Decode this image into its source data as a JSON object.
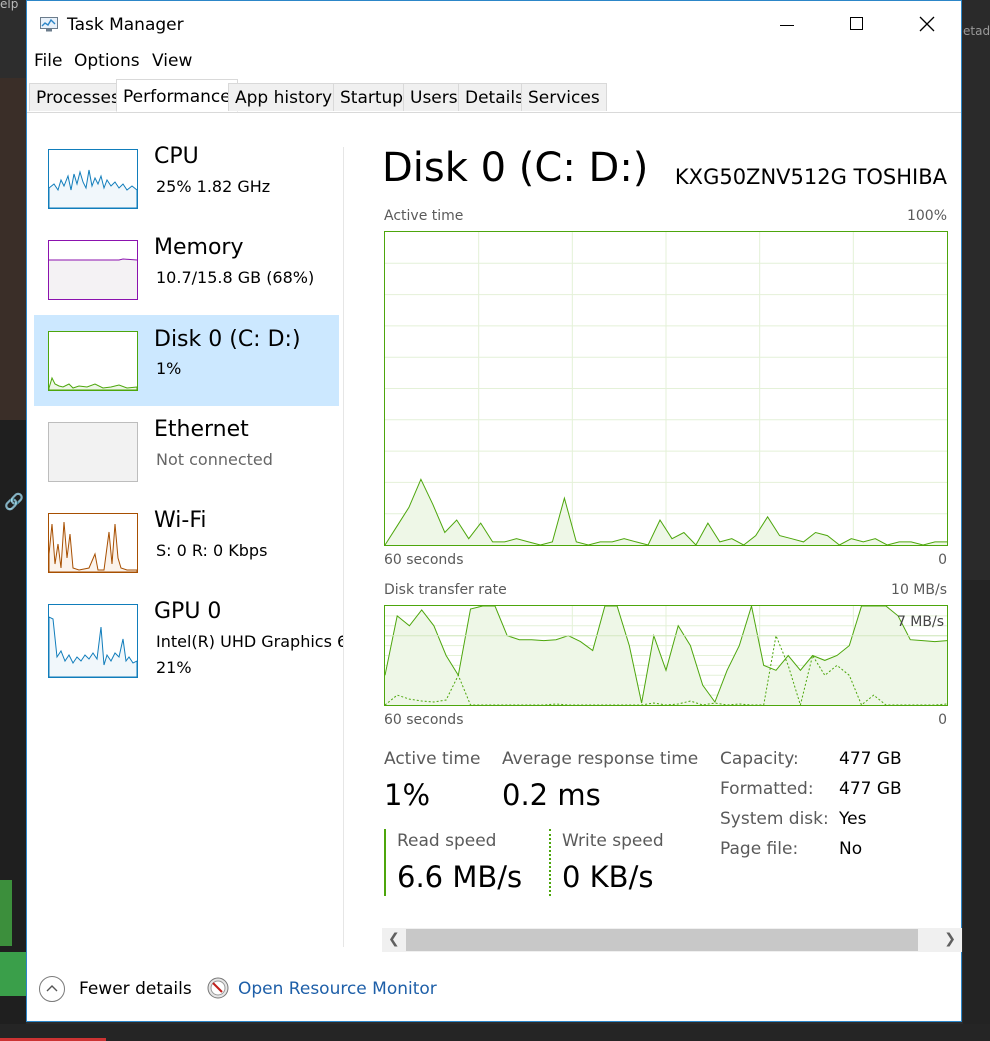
{
  "window": {
    "title": "Task Manager"
  },
  "menu": {
    "file": "File",
    "options": "Options",
    "view": "View"
  },
  "tabs": [
    "Processes",
    "Performance",
    "App history",
    "Startup",
    "Users",
    "Details",
    "Services"
  ],
  "active_tab": "Performance",
  "sidebar": {
    "cpu": {
      "name": "CPU",
      "sub": "25%  1.82 GHz"
    },
    "memory": {
      "name": "Memory",
      "sub": "10.7/15.8 GB (68%)"
    },
    "disk": {
      "name": "Disk 0 (C: D:)",
      "sub": "1%"
    },
    "ethernet": {
      "name": "Ethernet",
      "sub": "Not connected"
    },
    "wifi": {
      "name": "Wi-Fi",
      "sub": "S: 0  R: 0 Kbps"
    },
    "gpu": {
      "name": "GPU 0",
      "sub": "Intel(R) UHD Graphics 6",
      "sub2": "21%"
    }
  },
  "main": {
    "title": "Disk 0 (C: D:)",
    "model": "KXG50ZNV512G TOSHIBA",
    "active_time_label": "Active time",
    "active_time_max": "100%",
    "graph_seconds": "60 seconds",
    "graph_zero": "0",
    "transfer_label": "Disk transfer rate",
    "transfer_max": "10 MB/s",
    "transfer_marker": "7 MB/s"
  },
  "stats": {
    "active_time": {
      "label": "Active time",
      "value": "1%"
    },
    "avg_response": {
      "label": "Average response time",
      "value": "0.2 ms"
    },
    "read_speed": {
      "label": "Read speed",
      "value": "6.6 MB/s"
    },
    "write_speed": {
      "label": "Write speed",
      "value": "0 KB/s"
    }
  },
  "details": [
    {
      "label": "Capacity:",
      "value": "477 GB"
    },
    {
      "label": "Formatted:",
      "value": "477 GB"
    },
    {
      "label": "System disk:",
      "value": "Yes"
    },
    {
      "label": "Page file:",
      "value": "No"
    }
  ],
  "footer": {
    "fewer_details": "Fewer details",
    "open_resmon": "Open Resource Monitor"
  },
  "background": {
    "help_text": "elp",
    "right_text": "etad"
  },
  "colors": {
    "disk_green": "#4da60c",
    "cpu_blue": "#117dbb",
    "memory_purple": "#8b12ae",
    "wifi_orange": "#a74f01",
    "selected_bg": "#cce8ff",
    "link_blue": "#1e5fa8"
  },
  "series": {
    "active_time_pct": [
      0,
      6,
      12,
      21,
      13,
      4,
      8,
      2,
      7,
      1,
      1,
      2,
      1,
      0,
      1,
      15,
      1,
      0,
      1,
      1,
      2,
      1,
      0,
      8,
      2,
      4,
      0,
      7,
      1,
      2,
      0,
      3,
      9,
      3,
      2,
      1,
      4,
      3,
      0,
      2,
      1,
      2,
      0,
      1,
      1,
      0,
      1,
      1
    ],
    "transfer_read": [
      3,
      9,
      8,
      9.6,
      8,
      5,
      3,
      9.7,
      10,
      10,
      7,
      6.6,
      6.6,
      6.5,
      6.6,
      7,
      6.4,
      5.5,
      10,
      10,
      6,
      0.2,
      7,
      3.5,
      8,
      6,
      2,
      0.3,
      3.5,
      6,
      10,
      4,
      3.5,
      5,
      3.5,
      5,
      4.5,
      5,
      6,
      10,
      10,
      10,
      9,
      6.6,
      6.5,
      6.4,
      6.5
    ],
    "transfer_write": [
      0,
      1,
      0.6,
      0.4,
      0.3,
      0.5,
      3,
      0,
      0,
      0,
      0,
      0,
      0,
      0,
      0.1,
      0,
      0,
      0,
      0,
      0,
      0,
      0,
      0.2,
      0,
      0.1,
      0.4,
      0,
      0.2,
      0,
      0.1,
      0,
      0,
      7,
      4,
      0,
      5,
      3,
      4,
      3,
      0,
      1,
      0,
      0,
      0,
      0,
      0,
      0.1
    ]
  }
}
